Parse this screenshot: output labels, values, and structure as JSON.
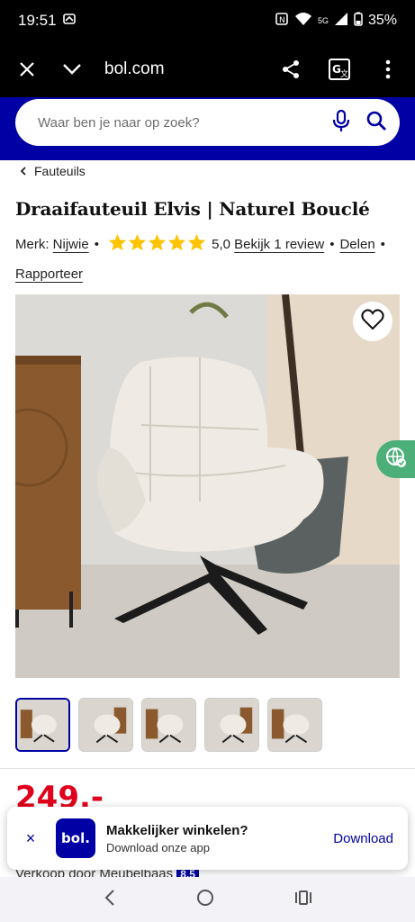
{
  "status_bar": {
    "time": "19:51",
    "battery": "35%",
    "network": "5G"
  },
  "browser": {
    "url": "bol.com"
  },
  "search": {
    "placeholder": "Waar ben je naar op zoek?"
  },
  "breadcrumb": {
    "label": "Fauteuils"
  },
  "product": {
    "title": "Draaifauteuil Elvis | Naturel Bouclé",
    "brand_prefix": "Merk:",
    "brand": "Nijwie",
    "rating": "5,0",
    "rating_stars": 5,
    "review_link": "Bekijk 1 review",
    "share_link": "Delen",
    "report_link": "Rapporteer",
    "price": "249,-"
  },
  "thumbnails": {
    "count": 5,
    "active_index": 0
  },
  "seller": {
    "label": "Verkoop door Meubelbaas",
    "score": "8,5"
  },
  "app_banner": {
    "close": "×",
    "logo": "bol.",
    "title": "Makkelijker winkelen?",
    "subtitle": "Download onze app",
    "download": "Download"
  },
  "colors": {
    "brand_blue": "#0000a4",
    "price_red": "#e0001b",
    "star_yellow": "#ffc300",
    "badge_green": "#4caf7a"
  },
  "icons": [
    "close-icon",
    "chevron-down-icon",
    "share-icon",
    "translate-icon",
    "more-icon",
    "mic-icon",
    "search-icon",
    "heart-icon",
    "back-icon",
    "home-icon",
    "recents-icon"
  ]
}
